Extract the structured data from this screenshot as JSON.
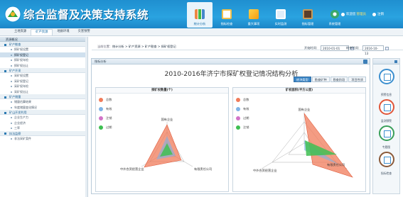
{
  "app": {
    "title": "综合监督及决策支持系统"
  },
  "topnav": [
    {
      "label": "统计分析",
      "icon": "bar-chart-icon",
      "active": true
    },
    {
      "label": "指标检查",
      "icon": "clipboard-icon"
    },
    {
      "label": "重大事项",
      "icon": "flag-icon"
    },
    {
      "label": "实时监测",
      "icon": "monitor-icon"
    },
    {
      "label": "指标管理",
      "icon": "briefcase-icon"
    },
    {
      "label": "系统管理",
      "icon": "gear-icon"
    }
  ],
  "user": {
    "welcome": "欢迎您",
    "name": "管理员",
    "logout": "注销"
  },
  "tabs": [
    "土地资源",
    "矿产资源",
    "地质环境",
    "灾害预警"
  ],
  "sidebar": {
    "header": "资源概况",
    "groups": [
      {
        "label": "矿产勘查",
        "items": [
          "探矿权设置",
          "探矿权登记",
          "探矿权年检",
          "探矿权出让"
        ]
      },
      {
        "label": "矿产开采",
        "items": [
          "采矿权设置",
          "采矿权登记",
          "采矿权年检",
          "采矿权出让"
        ]
      },
      {
        "label": "矿产储量",
        "items": [
          "储量估算结果",
          "年度储量变化情况"
        ]
      },
      {
        "label": "矿山开发利用",
        "items": [
          "企业生产力",
          "企业经济",
          "三率"
        ]
      },
      {
        "label": "执法监察",
        "items": [
          "非法采矿案件"
        ]
      }
    ]
  },
  "breadcrumb": {
    "prefix": "当前位置：",
    "path": "统计分析 > 矿产资源 > 矿产勘查 > 探矿权登记"
  },
  "dates": {
    "start_label": "开始时间：",
    "start": "2010-01-01",
    "end_label": "结束时间：",
    "end": "2016-10-13"
  },
  "panel": {
    "header": "指标分析",
    "title": "2010-2016年济宁市探矿权登记情况结构分析",
    "tabs": [
      "经济类型",
      "勘查矿种",
      "勘查阶段",
      "项目性质"
    ]
  },
  "charts": [
    {
      "title": "探矿权数量(个)",
      "legend": [
        "总数",
        "有效",
        "注销",
        "过期"
      ],
      "axes": [
        "国有企业",
        "有限责任公司",
        "中外合资经营企业"
      ]
    },
    {
      "title": "矿权面积(平方公里)",
      "legend": [
        "总数",
        "有效",
        "过期",
        "注销"
      ],
      "axes": [
        "国有企业",
        "有限责任公司",
        "中外合资经营企业"
      ]
    }
  ],
  "legend_colors": [
    "#f07b5a",
    "#7fb3e6",
    "#d274c8",
    "#3fbf52"
  ],
  "right_widgets": [
    "统计分析",
    "预警信息",
    "监测预警",
    "专题图",
    "指标检查"
  ]
}
